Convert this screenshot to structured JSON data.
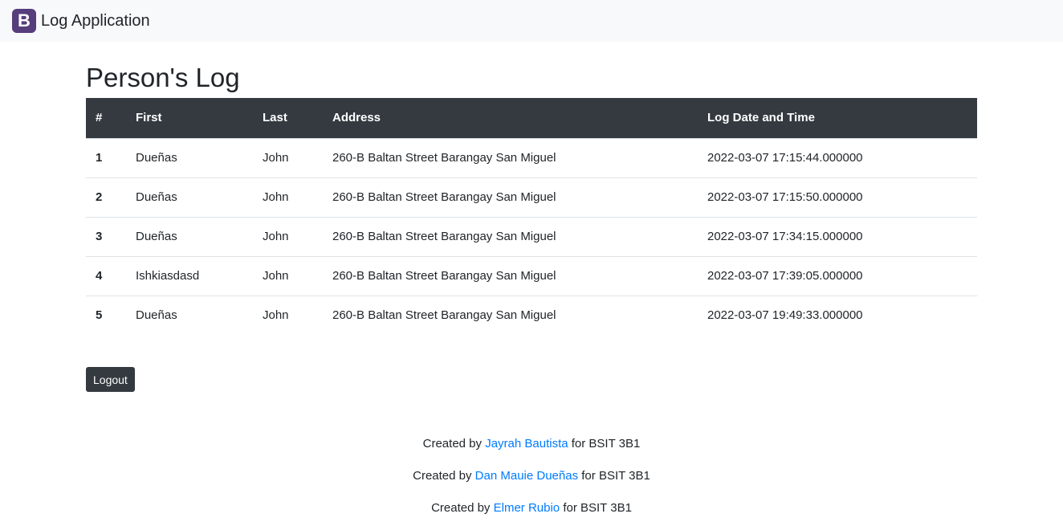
{
  "navbar": {
    "logo_letter": "B",
    "title": "Log Application"
  },
  "page": {
    "title": "Person's Log"
  },
  "table": {
    "headers": [
      "#",
      "First",
      "Last",
      "Address",
      "Log Date and Time"
    ],
    "rows": [
      {
        "num": "1",
        "first": "Dueñas",
        "last": "John",
        "address": "260-B Baltan Street Barangay San Miguel",
        "datetime": "2022-03-07 17:15:44.000000"
      },
      {
        "num": "2",
        "first": "Dueñas",
        "last": "John",
        "address": "260-B Baltan Street Barangay San Miguel",
        "datetime": "2022-03-07 17:15:50.000000"
      },
      {
        "num": "3",
        "first": "Dueñas",
        "last": "John",
        "address": "260-B Baltan Street Barangay San Miguel",
        "datetime": "2022-03-07 17:34:15.000000"
      },
      {
        "num": "4",
        "first": "Ishkiasdasd",
        "last": "John",
        "address": "260-B Baltan Street Barangay San Miguel",
        "datetime": "2022-03-07 17:39:05.000000"
      },
      {
        "num": "5",
        "first": "Dueñas",
        "last": "John",
        "address": "260-B Baltan Street Barangay San Miguel",
        "datetime": "2022-03-07 19:49:33.000000"
      }
    ]
  },
  "actions": {
    "logout_label": "Logout"
  },
  "footer": {
    "credits": [
      {
        "prefix": "Created by",
        "name": "Jayrah Bautista",
        "suffix": "for BSIT 3B1"
      },
      {
        "prefix": "Created by",
        "name": "Dan Mauie Dueñas",
        "suffix": "for BSIT 3B1"
      },
      {
        "prefix": "Created by",
        "name": "Elmer Rubio",
        "suffix": "for BSIT 3B1"
      }
    ]
  },
  "colors": {
    "navbar_bg": "#f8f9fa",
    "brand_purple": "#563d7c",
    "table_header_bg": "#343a40",
    "link": "#007bff"
  }
}
